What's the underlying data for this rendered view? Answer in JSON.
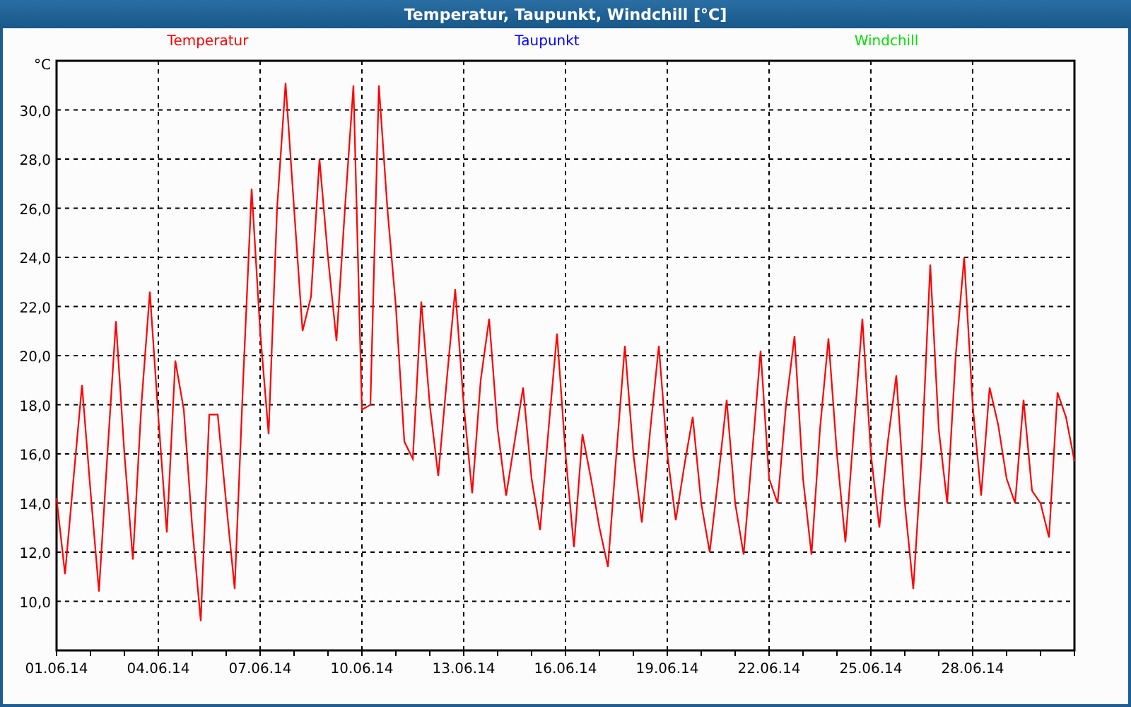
{
  "window": {
    "title": "Temperatur, Taupunkt, Windchill [°C]"
  },
  "chart": {
    "unit": "°C",
    "chart_data": {
      "type": "line",
      "grid": true,
      "ylim": [
        8,
        32
      ],
      "categories": [
        "01.06.14",
        null,
        null,
        null,
        null,
        null,
        null,
        null,
        null,
        null,
        null,
        null,
        "04.06.14",
        null,
        null,
        null,
        null,
        null,
        null,
        null,
        null,
        null,
        null,
        null,
        "07.06.14",
        null,
        null,
        null,
        null,
        null,
        null,
        null,
        null,
        null,
        null,
        null,
        "10.06.14",
        null,
        null,
        null,
        null,
        null,
        null,
        null,
        null,
        null,
        null,
        null,
        "13.06.14",
        null,
        null,
        null,
        null,
        null,
        null,
        null,
        null,
        null,
        null,
        null,
        "16.06.14",
        null,
        null,
        null,
        null,
        null,
        null,
        null,
        null,
        null,
        null,
        null,
        "19.06.14",
        null,
        null,
        null,
        null,
        null,
        null,
        null,
        null,
        null,
        null,
        null,
        "22.06.14",
        null,
        null,
        null,
        null,
        null,
        null,
        null,
        null,
        null,
        null,
        null,
        "25.06.14",
        null,
        null,
        null,
        null,
        null,
        null,
        null,
        null,
        null,
        null,
        null,
        "28.06.14",
        null,
        null,
        null,
        null,
        null,
        null,
        null,
        null,
        null,
        null,
        null,
        null
      ],
      "yticks": [
        {
          "value": 10,
          "label": "10,0"
        },
        {
          "value": 12,
          "label": "12,0"
        },
        {
          "value": 14,
          "label": "14,0"
        },
        {
          "value": 16,
          "label": "16,0"
        },
        {
          "value": 18,
          "label": "18,0"
        },
        {
          "value": 20,
          "label": "20,0"
        },
        {
          "value": 22,
          "label": "22,0"
        },
        {
          "value": 24,
          "label": "24,0"
        },
        {
          "value": 26,
          "label": "26,0"
        },
        {
          "value": 28,
          "label": "28,0"
        },
        {
          "value": 30,
          "label": "30,0"
        }
      ],
      "series": [
        {
          "name": "Temperatur",
          "color": "#ff0000",
          "values": [
            14.2,
            11.1,
            15,
            18.8,
            14.5,
            10.4,
            16,
            21.4,
            16,
            11.7,
            18,
            22.6,
            17.5,
            12.8,
            19.8,
            17.8,
            13,
            9.2,
            17.6,
            17.6,
            14,
            10.5,
            19,
            26.8,
            21,
            16.8,
            26,
            31.1,
            26,
            21,
            22.4,
            28.0,
            24,
            20.6,
            26,
            31.0,
            17.8,
            18.0,
            31.0,
            26,
            22,
            16.5,
            15.8,
            22.2,
            18,
            15.1,
            19,
            22.7,
            18,
            14.4,
            19,
            21.5,
            17,
            14.3,
            16.5,
            18.7,
            15,
            12.9,
            17,
            20.9,
            16,
            12.2,
            16.8,
            15,
            13,
            11.4,
            16,
            20.4,
            16,
            13.2,
            17,
            20.4,
            16,
            13.3,
            15.5,
            17.5,
            14,
            12.0,
            15,
            18.2,
            14,
            11.9,
            16,
            20.2,
            15,
            14.0,
            18,
            20.8,
            15,
            11.9,
            17,
            20.7,
            16,
            12.4,
            17,
            21.5,
            16,
            13.0,
            16.5,
            19.2,
            14,
            10.5,
            16,
            23.7,
            17,
            14.0,
            20,
            24.0,
            18,
            14.3,
            18.7,
            17.2,
            15,
            14.0,
            18.2,
            14.5,
            14,
            12.6,
            18.5,
            17.5,
            15.7
          ]
        },
        {
          "name": "Taupunkt",
          "color": "#0000ff",
          "values": [
            null,
            null,
            null,
            null,
            null,
            null,
            null,
            null,
            null,
            null,
            null,
            null,
            null,
            null,
            null,
            null,
            null,
            null,
            null,
            null,
            null,
            null,
            null,
            null,
            null,
            null,
            null,
            null,
            null,
            null,
            null,
            null,
            null,
            null,
            null,
            null,
            null,
            null,
            null,
            null,
            null,
            null,
            null,
            null,
            null,
            null,
            null,
            null,
            null,
            null,
            null,
            null,
            null,
            null,
            null,
            null,
            null,
            null,
            null,
            null,
            null,
            null,
            null,
            null,
            null,
            null,
            null,
            null,
            null,
            null,
            null,
            null,
            null,
            null,
            null,
            null,
            null,
            null,
            null,
            null,
            null,
            null,
            null,
            null,
            null,
            null,
            null,
            null,
            null,
            null,
            null,
            null,
            null,
            null,
            null,
            null,
            null,
            null,
            null,
            null,
            null,
            null,
            null,
            null,
            null,
            null,
            null,
            null,
            null,
            null,
            null,
            null,
            null,
            null,
            null,
            null,
            null,
            null,
            null,
            null,
            null
          ]
        },
        {
          "name": "Windchill",
          "color": "#00e000",
          "values": [
            null,
            null,
            null,
            null,
            null,
            null,
            null,
            null,
            null,
            null,
            null,
            null,
            null,
            null,
            null,
            null,
            null,
            null,
            null,
            null,
            null,
            null,
            null,
            null,
            null,
            null,
            null,
            null,
            null,
            null,
            null,
            null,
            null,
            null,
            null,
            null,
            null,
            null,
            null,
            null,
            null,
            null,
            null,
            null,
            null,
            null,
            null,
            null,
            null,
            null,
            null,
            null,
            null,
            null,
            null,
            null,
            null,
            null,
            null,
            null,
            null,
            null,
            null,
            null,
            null,
            null,
            null,
            null,
            null,
            null,
            null,
            null,
            null,
            null,
            null,
            null,
            null,
            null,
            null,
            null,
            null,
            null,
            null,
            null,
            null,
            null,
            null,
            null,
            null,
            null,
            null,
            null,
            null,
            null,
            null,
            null,
            null,
            null,
            null,
            null,
            null,
            null,
            null,
            null,
            null,
            null,
            null,
            null,
            null,
            null,
            null,
            null,
            null,
            null,
            null,
            null,
            null,
            null,
            null,
            null,
            null
          ]
        }
      ]
    }
  }
}
